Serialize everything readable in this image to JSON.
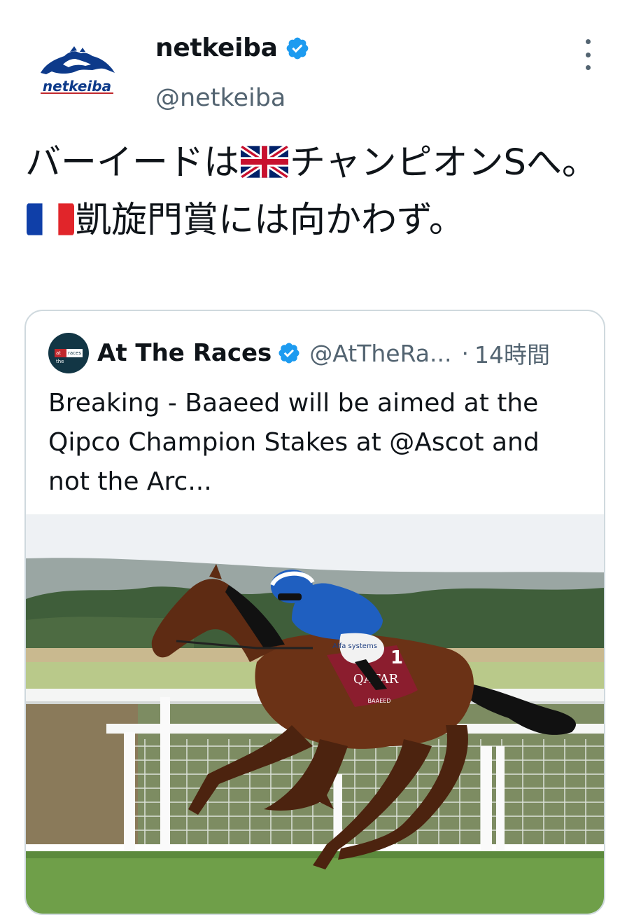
{
  "tweet": {
    "display_name": "netkeiba",
    "handle": "@netkeiba",
    "avatar_logo_text": "netkeiba",
    "text_part1": "バーイードは",
    "flag1": "uk-flag",
    "text_part2": "チャンピオンSへ。",
    "flag2": "france-flag",
    "text_part3": "凱旋門賞には向かわず。"
  },
  "quoted": {
    "avatar_logo": [
      "at the",
      "races"
    ],
    "display_name": "At The Races",
    "handle": "@AtTheRa...",
    "separator": "·",
    "time": "14時間",
    "text": "Breaking - Baaeed will be aimed at the Qipco Champion Stakes at @Ascot and not the Arc...",
    "image_alt": "Jockey in blue silks riding bay racehorse Baaeed at full gallop past white rails",
    "saddle_cloth_number": "1",
    "saddle_cloth_text": "QATAR",
    "saddle_cloth_name": "BAAEED",
    "silks_sponsor": "Alfa systems"
  },
  "icons": {
    "verified": "verified-badge-icon",
    "more": "more-vertical-icon"
  },
  "colors": {
    "verified_blue": "#1d9bf0",
    "text": "#0f1419",
    "secondary": "#536471",
    "border": "#cfd9de"
  }
}
